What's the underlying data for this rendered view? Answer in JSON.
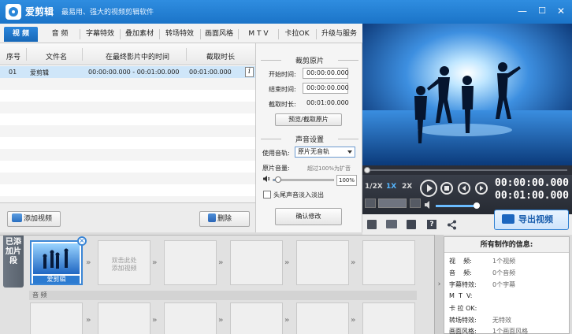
{
  "app": {
    "name": "爱剪辑",
    "slogan": "最易用、强大的视频剪辑软件"
  },
  "window_controls": {
    "minimize": "—",
    "maximize": "☐",
    "close": "✕"
  },
  "tabs": [
    {
      "label": "视 频",
      "active": true
    },
    {
      "label": "音 频"
    },
    {
      "label": "字幕特效"
    },
    {
      "label": "叠加素材"
    },
    {
      "label": "转场特效"
    },
    {
      "label": "画面风格"
    },
    {
      "label": "M T V"
    },
    {
      "label": "卡拉OK"
    },
    {
      "label": "升级与服务"
    }
  ],
  "clip_list": {
    "columns": [
      "序号",
      "文件名",
      "在最终影片中的时间",
      "截取时长"
    ],
    "rows": [
      {
        "index": "01",
        "name": "爱剪辑",
        "time": "00:00:00.000 - 00:01:00.000",
        "duration": "00:01:00.000",
        "info": "i"
      }
    ],
    "add_button": "添加视频",
    "delete_button": "删除"
  },
  "crop": {
    "title": "裁剪原片",
    "start_label": "开始时间:",
    "start_value": "00:00:00.000",
    "end_label": "结束时间:",
    "end_value": "00:00:00.000",
    "duration_label": "截取时长:",
    "duration_value": "00:01:00.000",
    "preview_button": "预览/截取原片"
  },
  "sound": {
    "title": "声音设置",
    "track_label": "使用音轨:",
    "track_value": "原片无音轨",
    "volume_label": "原片音量:",
    "volume_hint": "超过100%为扩音",
    "volume_percent": "100%",
    "volume_level": 0.08,
    "fade_label": "头尾声音淡入淡出",
    "confirm_button": "确认修改"
  },
  "player": {
    "speeds": [
      "1/2X",
      "1X",
      "2X"
    ],
    "current_time": "00:00:00.000",
    "total_time": "00:01:00.000",
    "progress": 0,
    "volume_level": 0.92,
    "export_button": "导出视频"
  },
  "timeline": {
    "side_tab": "已添加片段",
    "first_clip_label": "爱剪辑",
    "placeholder": "双击此处\n添加视频",
    "audio_label": "音 频"
  },
  "info_panel": {
    "title": "所有制作的信息:",
    "rows": [
      {
        "key": "视    频:",
        "value": "1个视频"
      },
      {
        "key": "音    频:",
        "value": "0个音频"
      },
      {
        "key": "字幕特效:",
        "value": "0个字幕"
      },
      {
        "key": "M  T  V:",
        "value": ""
      },
      {
        "key": "卡 拉 OK:",
        "value": ""
      },
      {
        "key": "转场特效:",
        "value": "无特效"
      },
      {
        "key": "画面风格:",
        "value": "1个画面风格"
      }
    ]
  },
  "colors": {
    "title_bar": "#1e7ad0",
    "tab_active": "#1f76c9",
    "row_selected": "#cfe6f9",
    "player_bg": "#2b2f37",
    "timecode": "#ffffff"
  }
}
